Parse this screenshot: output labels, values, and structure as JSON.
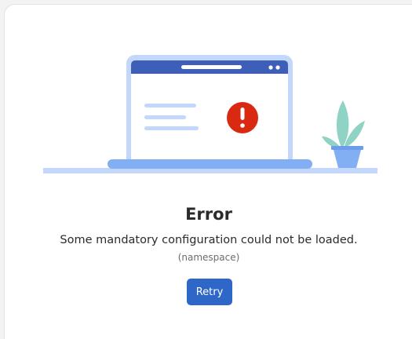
{
  "error": {
    "title": "Error",
    "message": "Some mandatory configuration could not be loaded.",
    "detail": "(namespace)"
  },
  "actions": {
    "retry_label": "Retry"
  },
  "illustration": {
    "icons": [
      "laptop-icon",
      "error-alert-icon",
      "plant-icon"
    ]
  },
  "colors": {
    "accent": "#2f67c8",
    "alert": "#d92911",
    "laptop_frame": "#c2d7fb",
    "laptop_header": "#3e5fb8",
    "text_lines": "#c2d7fb",
    "plant_leaves": "#8fd3c4",
    "pot": "#82aef3"
  }
}
